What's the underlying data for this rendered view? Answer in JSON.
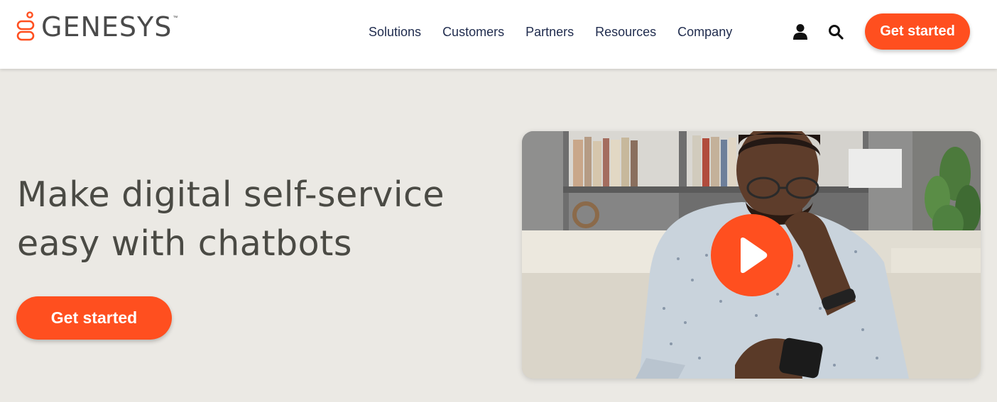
{
  "header": {
    "brand": "GENESYS",
    "brand_mark": "™",
    "nav": [
      "Solutions",
      "Customers",
      "Partners",
      "Resources",
      "Company"
    ],
    "account_icon": "user-icon",
    "search_icon": "search-icon",
    "cta_label": "Get started"
  },
  "hero": {
    "title_line1": "Make digital self-service",
    "title_line2": "easy with chatbots",
    "cta_label": "Get started",
    "video": {
      "play_icon": "play-icon"
    }
  },
  "colors": {
    "accent": "#ff4f1f",
    "nav_text": "#1f2b4d",
    "heading": "#4a4a44",
    "page_background": "#ebe9e4"
  }
}
